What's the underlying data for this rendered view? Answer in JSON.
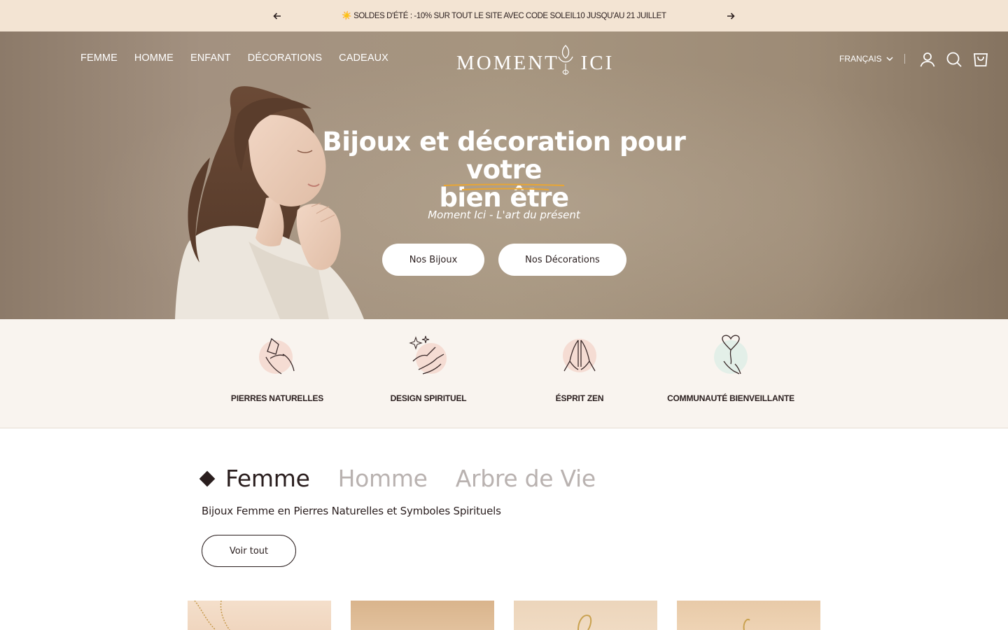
{
  "announcement": {
    "text": "☀️ SOLDES D'ÉTÉ : -10% SUR TOUT LE SITE AVEC CODE SOLEIL10 JUSQU'AU 21 JUILLET"
  },
  "nav": {
    "items": [
      "FEMME",
      "HOMME",
      "ENFANT",
      "DÉCORATIONS",
      "CADEAUX"
    ]
  },
  "logo": {
    "text": "MOMENT ICI"
  },
  "header": {
    "language": "FRANÇAIS"
  },
  "hero": {
    "title_line1": "Bijoux et décoration pour votre",
    "title_line2": "bien être",
    "subtitle": "Moment Ici - L'art du présent",
    "button_bijoux": "Nos Bijoux",
    "button_decorations": "Nos Décorations"
  },
  "features": [
    {
      "label": "PIERRES NATURELLES",
      "icon": "crystal-hand-icon"
    },
    {
      "label": "DESIGN SPIRITUEL",
      "icon": "sparkle-hands-icon"
    },
    {
      "label": "ÉSPRIT ZEN",
      "icon": "praying-hands-icon"
    },
    {
      "label": "COMMUNAUTÉ BIENVEILLANTE",
      "icon": "heart-balloon-icon"
    }
  ],
  "collections": {
    "tabs": [
      "Femme",
      "Homme",
      "Arbre de Vie"
    ],
    "description": "Bijoux Femme en Pierres Naturelles et Symboles Spirituels",
    "view_all": "Voir tout"
  },
  "colors": {
    "announcement_bg": "#f3e4d3",
    "features_bg": "#f9f4ef",
    "text_dark": "#2a1e1e",
    "tab_inactive": "#b9b2b0",
    "underline_accent": "#e8a533"
  }
}
